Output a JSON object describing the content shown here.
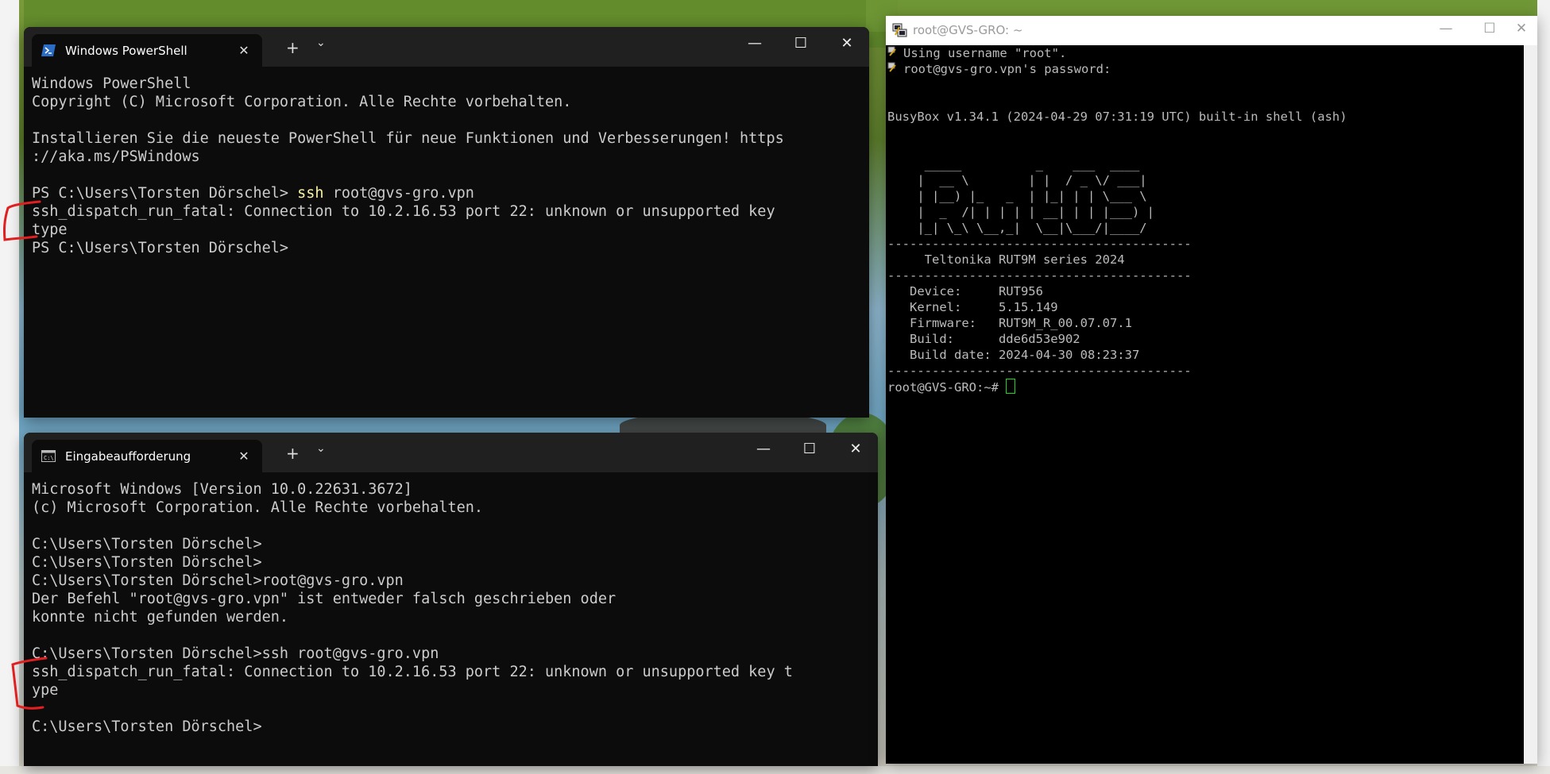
{
  "powershell": {
    "tab_title": "Windows PowerShell",
    "lines": [
      "Windows PowerShell",
      "Copyright (C) Microsoft Corporation. Alle Rechte vorbehalten.",
      "",
      "Installieren Sie die neueste PowerShell für neue Funktionen und Verbesserungen! https",
      "://aka.ms/PSWindows",
      "",
      "PS C:\\Users\\Torsten Dörschel> "
    ],
    "prompt_command_keyword": "ssh",
    "prompt_command_rest": " root@gvs-gro.vpn",
    "after_lines": [
      "ssh_dispatch_run_fatal: Connection to 10.2.16.53 port 22: unknown or unsupported key",
      "type",
      "PS C:\\Users\\Torsten Dörschel>"
    ]
  },
  "cmd": {
    "tab_title": "Eingabeaufforderung",
    "text": "Microsoft Windows [Version 10.0.22631.3672]\n(c) Microsoft Corporation. Alle Rechte vorbehalten.\n\nC:\\Users\\Torsten Dörschel>\nC:\\Users\\Torsten Dörschel>\nC:\\Users\\Torsten Dörschel>root@gvs-gro.vpn\nDer Befehl \"root@gvs-gro.vpn\" ist entweder falsch geschrieben oder\nkonnte nicht gefunden werden.\n\nC:\\Users\\Torsten Dörschel>ssh root@gvs-gro.vpn\nssh_dispatch_run_fatal: Connection to 10.2.16.53 port 22: unknown or unsupported key t\nype\n\nC:\\Users\\Torsten Dörschel>"
  },
  "putty": {
    "title": "root@GVS-GRO: ~",
    "line1": "Using username \"root\".",
    "line2": "root@gvs-gro.vpn's password:",
    "body": "\n\nBusyBox v1.34.1 (2024-04-29 07:31:19 UTC) built-in shell (ash)\n\n\n     _____          _    ___  ____\n    |  __ \\        | |  / _ \\/ ___|\n    | |__) |_   _  | |_| | | \\___ \\\n    |  _  /| | | | | __| | | |___) |\n    |_| \\_\\ \\__,_|  \\__|\\___/|____/\n-----------------------------------------\n     Teltonika RUT9M series 2024\n-----------------------------------------\n   Device:     RUT956\n   Kernel:     5.15.149\n   Firmware:   RUT9M_R_00.07.07.1\n   Build:      dde6d53e902\n   Build date: 2024-04-30 08:23:37\n-----------------------------------------",
    "prompt": "root@GVS-GRO:~# "
  },
  "icons": {
    "close": "✕",
    "new_tab": "+",
    "dropdown": "⌄",
    "minimize": "—",
    "maximize": "☐"
  },
  "colors": {
    "terminal_bg": "#0c0c0c",
    "terminal_fg": "#cccccc",
    "command_yellow": "#f9f1a5",
    "annotation_red": "#e02020",
    "cursor_green": "#1fd41f"
  }
}
